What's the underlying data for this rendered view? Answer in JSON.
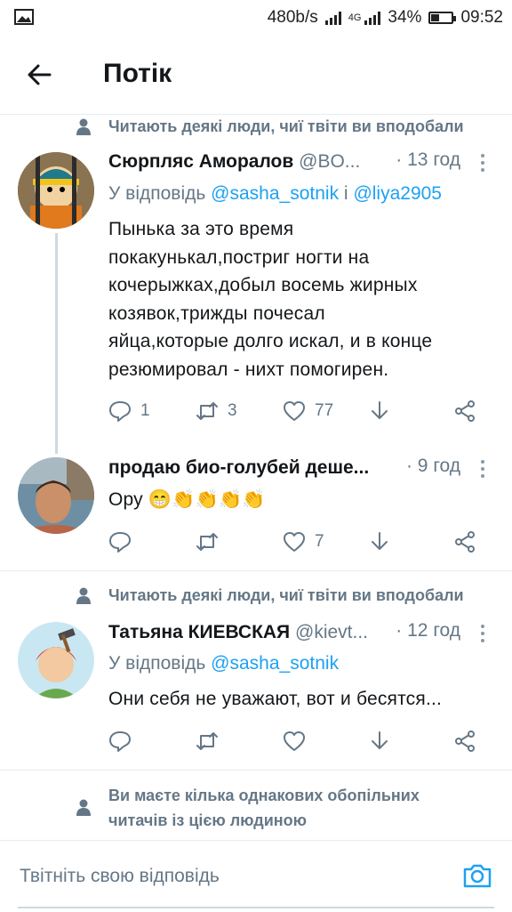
{
  "status_bar": {
    "network_speed": "480b/s",
    "network_type": "4G",
    "battery": "34%",
    "time": "09:52"
  },
  "header": {
    "title": "Потік"
  },
  "context_liked": "Читають деякі люди, чиї твіти ви вподобали",
  "context_mutual_1": "Ви маєте кілька однакових обопільних",
  "context_mutual_2": "читачів із цією людиною",
  "reply_prefix": "У відповідь",
  "reply_joiner": "і",
  "tweets": [
    {
      "name": "Сюрпляс Аморалов",
      "handle": "@BO...",
      "time": "· 13 год",
      "replying_to": [
        "@sasha_sotnik",
        "@liya2905"
      ],
      "text_lines": [
        "Пынька за это время",
        "покакунькал,постриг ногти на",
        "кочерыжках,добыл восемь жирных",
        "козявок,трижды почесал",
        "яйца,которые долго искал, и в конце",
        "резюмировал - нихт помогирен."
      ],
      "replies": "1",
      "retweets": "3",
      "likes": "77"
    },
    {
      "name": "продаю био-голубей деше...",
      "time": "· 9 год",
      "text": "Ору 😁👏👏👏👏",
      "replies": "",
      "retweets": "",
      "likes": "7"
    },
    {
      "name": "Татьяна КИЕВСКАЯ",
      "handle": "@kievt...",
      "time": "· 12 год",
      "replying_to": [
        "@sasha_sotnik"
      ],
      "text": "Они себя не уважают, вот и бесятся...",
      "replies": "",
      "retweets": "",
      "likes": ""
    }
  ],
  "composer": {
    "placeholder": "Твітніть свою відповідь"
  },
  "icons": {
    "accent": "#1da1f2",
    "muted": "#657786"
  }
}
